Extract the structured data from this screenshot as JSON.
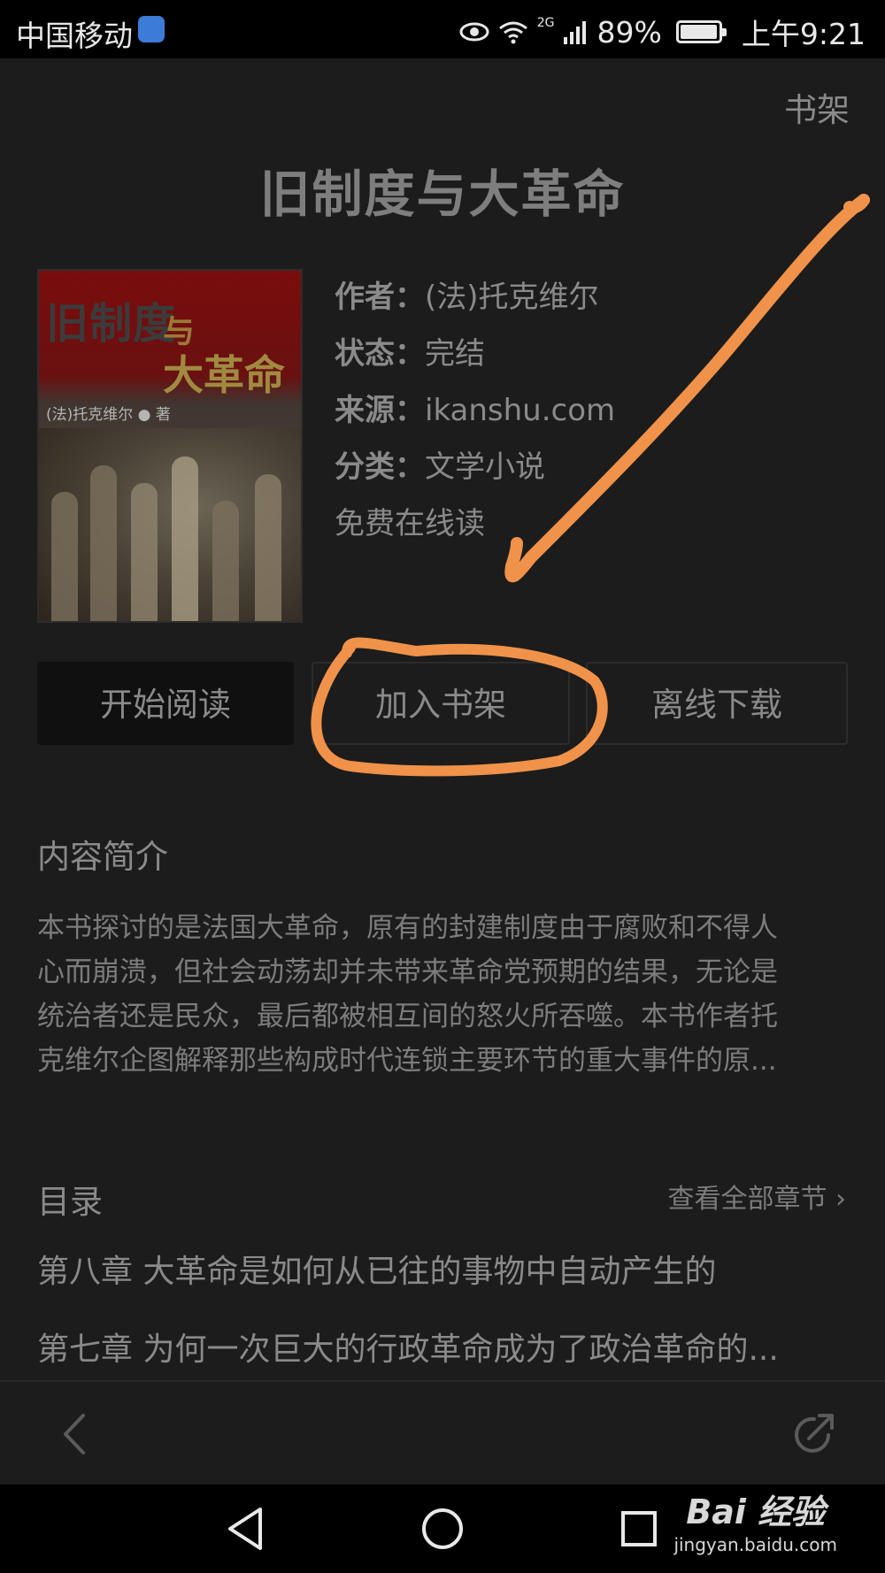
{
  "status_bar": {
    "carrier": "中国移动",
    "network": "2G",
    "battery": "89%",
    "battery_level": 0.89,
    "time": "上午9:21"
  },
  "header": {
    "shelf_link": "书架",
    "book_title": "旧制度与大革命"
  },
  "cover": {
    "title_part1": "旧制度",
    "title_part2": "与",
    "title_part3": "大革命",
    "author_line": "(法)托克维尔 ● 著"
  },
  "meta": [
    {
      "key": "作者：",
      "value": "(法)托克维尔"
    },
    {
      "key": "状态：",
      "value": "完结"
    },
    {
      "key": "来源：",
      "value": "ikanshu.com"
    },
    {
      "key": "分类：",
      "value": "文学小说"
    }
  ],
  "free_read": "免费在线读",
  "buttons": {
    "start_reading": "开始阅读",
    "add_to_shelf": "加入书架",
    "offline_download": "离线下载"
  },
  "intro": {
    "title": "内容简介",
    "lines": [
      "本书探讨的是法国大革命，原有的封建制度由于腐败和不得人",
      "心而崩溃，但社会动荡却并未带来革命党预期的结果，无论是",
      "统治者还是民众，最后都被相互间的怒火所吞噬。本书作者托",
      "克维尔企图解释那些构成时代连锁主要环节的重大事件的原..."
    ]
  },
  "toc": {
    "title": "目录",
    "view_all": "查看全部章节 ›",
    "chapters": [
      "第八章 大革命是如何从已往的事物中自动产生的",
      "第七章 为何一次巨大的行政革命成为了政治革命的..."
    ]
  },
  "watermark": {
    "logo": "Bai 经验",
    "url": "jingyan.baidu.com"
  },
  "colors": {
    "background": "#1c1c1c",
    "annotation": "#f0924a"
  },
  "icons": [
    "eye-icon",
    "wifi-icon",
    "signal-icon",
    "battery-icon",
    "back-icon",
    "share-icon",
    "nav-back-icon",
    "nav-home-icon",
    "nav-recents-icon",
    "baidu-paw-icon"
  ]
}
